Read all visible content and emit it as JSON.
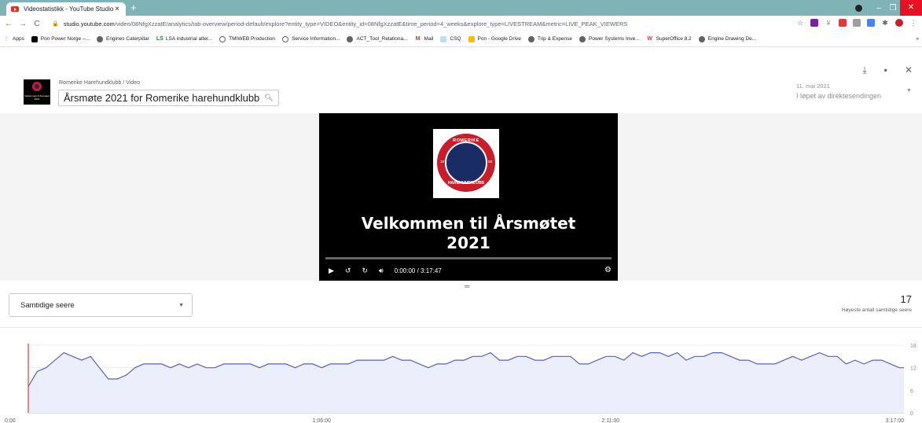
{
  "browser": {
    "tab_title": "Videostatistikk - YouTube Studio",
    "tab_close": "×",
    "new_tab": "+",
    "url_host": "studio.youtube.com",
    "url_path": "/video/08NfgXzzatE/analytics/tab-overview/period-default/explore?entity_type=VIDEO&entity_id=08NfgXzzatE&time_period=4_weeks&explore_type=LIVESTREAM&metric=LIVE_PEAK_VIEWERS",
    "bookmarks": [
      "Apps",
      "Pon Power Norge –...",
      "Engines Caterpillar",
      "LSA industrial alter...",
      "TMIWEB Production",
      "Service Information...",
      "ACT_Tool_Relationa...",
      "Mail",
      "CSQ",
      "Pon - Google Drive",
      "Trip & Expense",
      "Power Systems Inve...",
      "SuperOffice 8.2",
      "Engine Drawing De..."
    ],
    "bookmarks_more": "»"
  },
  "header": {
    "breadcrumb": "Romerike Harehundklubb  /  Video",
    "video_title": "Årsmøte 2021 for Romerike harehundklubb",
    "thumb_text": "Velkommen til Årsmøtet 2021",
    "date": "11. mai 2021",
    "period": "I løpet av direktesendingen"
  },
  "player": {
    "ring_top": "ROMERIKE",
    "ring_bottom": "HAREHUNDKLUBB",
    "ring_left": "19",
    "ring_right": "58",
    "title_line1": "Velkommen til Årsmøtet",
    "title_line2": "2021",
    "time": "0:00:00 / 3:17:47"
  },
  "metric": {
    "selected": "Samtidige seere",
    "kpi_value": "17",
    "kpi_label": "Høyeste antall samtidige seere"
  },
  "colors": {
    "series_line": "#5a5fc7",
    "series_fill": "#eceefb",
    "cursor": "#e53935"
  },
  "chart_data": {
    "type": "area",
    "x_tick_labels": [
      "0:00",
      "1:06:00",
      "2:11:00",
      "3:17:00"
    ],
    "y_ticks": [
      0,
      6,
      12,
      18
    ],
    "ylim": [
      0,
      18
    ],
    "x_minutes": [
      0,
      2,
      4,
      6,
      8,
      10,
      12,
      14,
      16,
      18,
      20,
      22,
      24,
      26,
      28,
      30,
      32,
      34,
      36,
      38,
      40,
      42,
      44,
      46,
      48,
      50,
      52,
      54,
      56,
      58,
      60,
      62,
      64,
      66,
      68,
      70,
      72,
      74,
      76,
      78,
      80,
      82,
      84,
      86,
      88,
      90,
      92,
      94,
      96,
      98,
      100,
      102,
      104,
      106,
      108,
      110,
      112,
      114,
      116,
      118,
      120,
      122,
      124,
      126,
      128,
      130,
      132,
      134,
      136,
      138,
      140,
      142,
      144,
      146,
      148,
      150,
      152,
      154,
      156,
      158,
      160,
      162,
      164,
      166,
      168,
      170,
      172,
      174,
      176,
      178,
      180,
      182,
      184,
      186,
      188,
      190,
      192,
      194,
      196,
      197
    ],
    "values": [
      7,
      11,
      12,
      14,
      16,
      15,
      14,
      15,
      12,
      9,
      9,
      10,
      12,
      13,
      13,
      13,
      12,
      13,
      12,
      13,
      12,
      12,
      13,
      13,
      13,
      13,
      12,
      13,
      13,
      13,
      12,
      13,
      13,
      12,
      13,
      13,
      13,
      14,
      14,
      14,
      14,
      15,
      14,
      14,
      13,
      12,
      13,
      13,
      14,
      14,
      15,
      15,
      16,
      14,
      14,
      15,
      15,
      14,
      14,
      15,
      15,
      15,
      13,
      13,
      14,
      15,
      15,
      14,
      16,
      15,
      16,
      16,
      15,
      16,
      14,
      15,
      15,
      16,
      16,
      15,
      14,
      14,
      13,
      13,
      13,
      14,
      15,
      14,
      15,
      16,
      15,
      15,
      13,
      14,
      13,
      14,
      14,
      13,
      12,
      12
    ]
  }
}
